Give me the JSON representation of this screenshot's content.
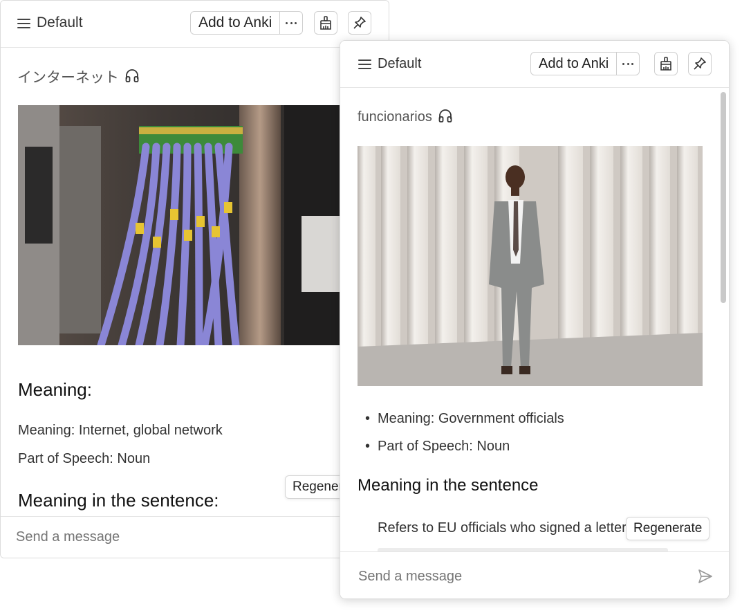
{
  "back_panel": {
    "deck": "Default",
    "add_to_anki": "Add to Anki",
    "word": "インターネット",
    "heading_meaning": "Meaning:",
    "meaning_line": "Meaning: Internet, global network",
    "pos_line": "Part of Speech: Noun",
    "heading_sentence": "Meaning in the sentence:",
    "regenerate": "Regenerate",
    "message_placeholder": "Send a message"
  },
  "front_panel": {
    "deck": "Default",
    "add_to_anki": "Add to Anki",
    "word": "funcionarios",
    "bullets": [
      "Meaning: Government officials",
      "Part of Speech: Noun"
    ],
    "heading_sentence": "Meaning in the sentence",
    "sentence_bullet": "Refers to EU officials who signed a letter",
    "regenerate": "Regenerate",
    "message_placeholder": "Send a message"
  },
  "icons": [
    "menu-icon",
    "more-icon",
    "broom-icon",
    "pin-icon",
    "headphones-icon",
    "send-icon"
  ],
  "colors": {
    "border": "#dcdcdc",
    "text": "#333333",
    "placeholder": "#b5b5b5",
    "cable_purple": "#8a86d6"
  }
}
